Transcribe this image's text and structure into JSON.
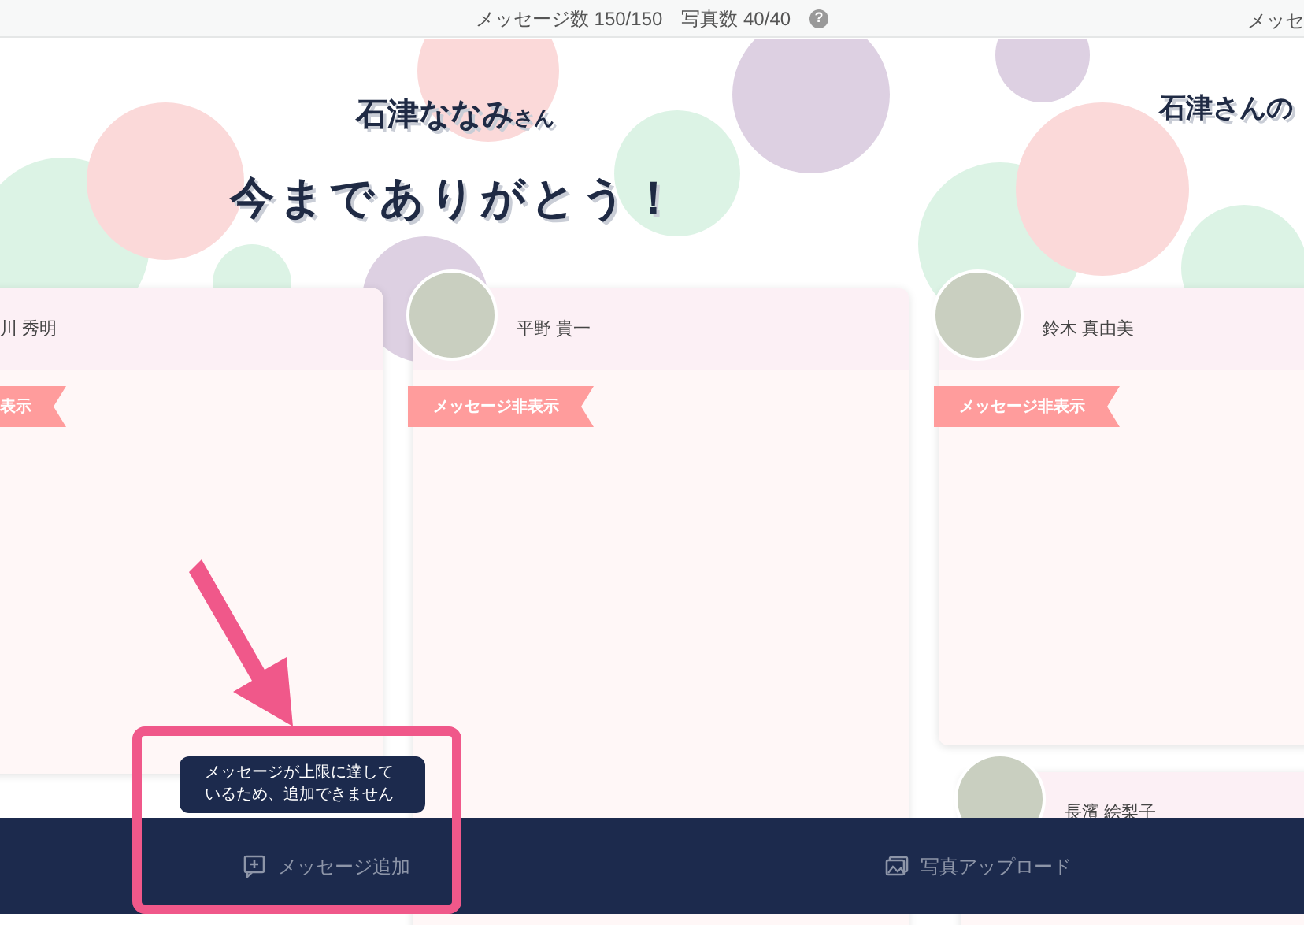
{
  "status_bar": {
    "message_count": "メッセージ数 150/150",
    "photo_count": "写真数 40/40",
    "help": "?",
    "overflow_text": "メッセ"
  },
  "pages": [
    {
      "recipient": "石津ななみ",
      "honorific": "さん",
      "headline": "今までありがとう！"
    },
    {
      "recipient": "石津さんの"
    }
  ],
  "cards": [
    {
      "name": "川 秀明",
      "photo": false,
      "ribbon": "表示"
    },
    {
      "name": "平野 貴一",
      "photo": true,
      "ribbon": "メッセージ非表示"
    },
    {
      "name": "鈴木 真由美",
      "photo": true,
      "ribbon": "メッセージ非表示"
    },
    {
      "name": "長濱 絵梨子",
      "photo": true
    }
  ],
  "tooltip": "メッセージが上限に達しているため、追加できません",
  "actions": [
    {
      "kind": "message",
      "label": "メッセージ追加"
    },
    {
      "kind": "photo",
      "label": "写真アップロード"
    }
  ]
}
